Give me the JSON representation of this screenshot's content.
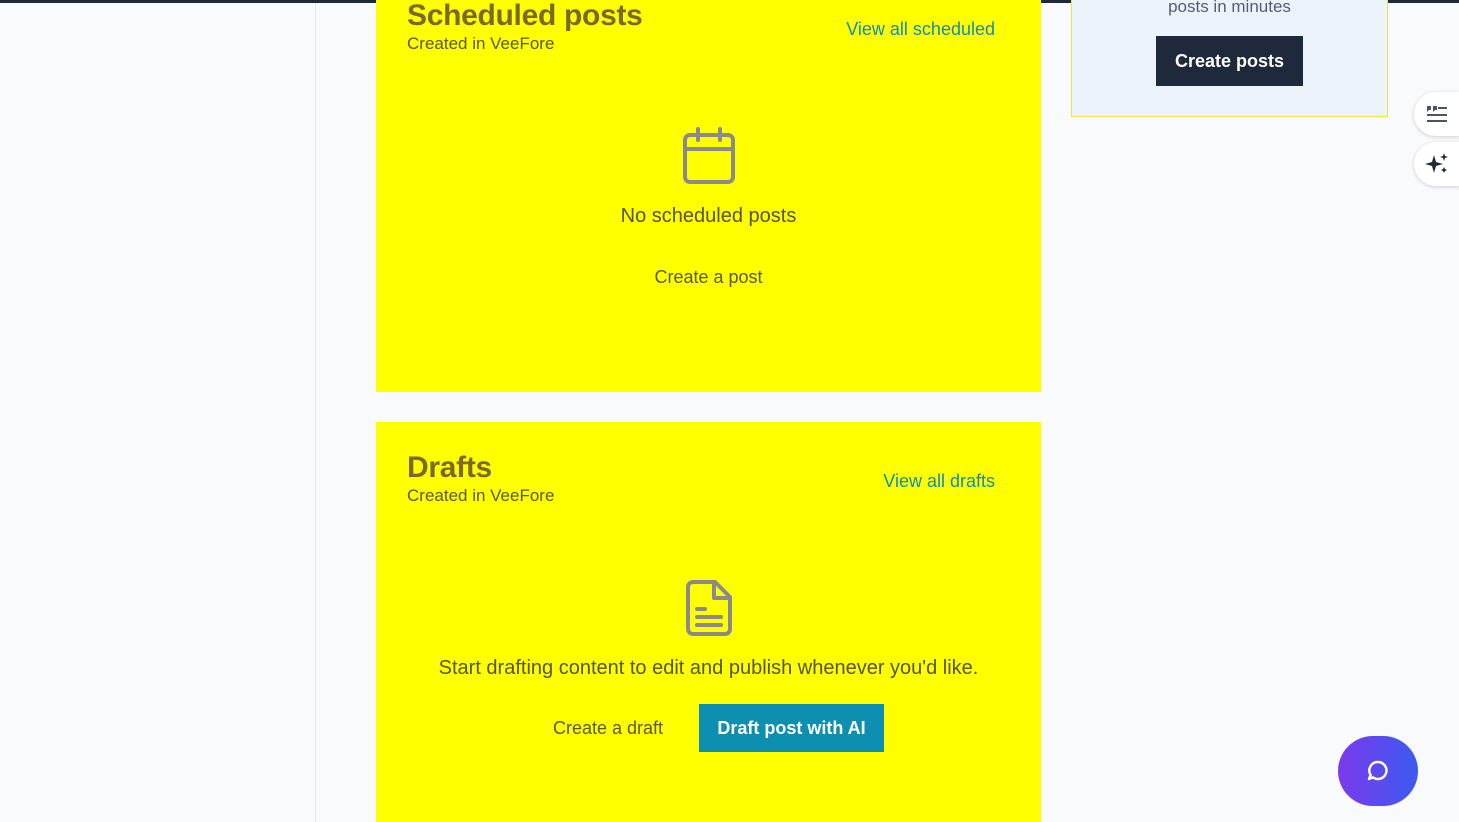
{
  "scheduled": {
    "title": "Scheduled posts",
    "subtitle": "Created in VeeFore",
    "view_all": "View all scheduled",
    "icon": "calendar-icon",
    "empty_text": "No scheduled posts",
    "create_label": "Create a post"
  },
  "drafts": {
    "title": "Drafts",
    "subtitle": "Created in VeeFore",
    "view_all": "View all drafts",
    "icon": "document-icon",
    "empty_text": "Start drafting content to edit and publish whenever you'd like.",
    "create_label": "Create a draft",
    "ai_label": "Draft post with AI"
  },
  "promo": {
    "text": "posts in minutes",
    "button_label": "Create posts"
  },
  "side_tabs": [
    {
      "icon": "quote-lines-icon"
    },
    {
      "icon": "sparkles-icon"
    }
  ],
  "chat": {
    "icon": "chat-bubble-icon"
  },
  "colors": {
    "card_bg": "#ffff00",
    "link": "#0e8fb3",
    "primary_button": "#0c8fb0",
    "dark_button": "#1e293b",
    "chat_gradient_start": "#7c3aed",
    "chat_gradient_end": "#3b5bf0"
  }
}
